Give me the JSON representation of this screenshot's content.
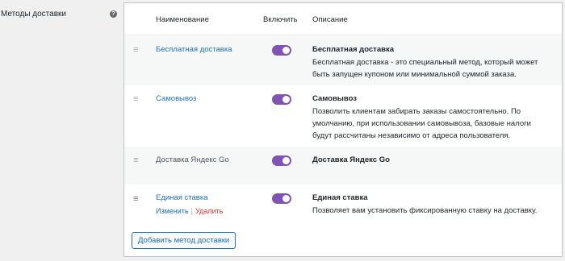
{
  "section": {
    "label": "Методы доставки",
    "help_glyph": "?"
  },
  "table": {
    "headers": {
      "name": "Наименование",
      "enable": "Включить",
      "description": "Описание"
    },
    "rows": [
      {
        "name": "Бесплатная доставка",
        "enabled": true,
        "desc_title": "Бесплатная доставка",
        "desc_text": "Бесплатная доставка - это специальный метод, который может быть запущен купоном или минимальной суммой заказа."
      },
      {
        "name": "Самовывоз",
        "enabled": true,
        "desc_title": "Самовывоз",
        "desc_text": "Позволить клиентам забирать заказы самостоятельно. По умолчанию, при использовании самовывоза, базовые налоги будут рассчитаны независимо от адреса пользователя."
      },
      {
        "name": "Доставка Яндекс Go",
        "enabled": true,
        "desc_title": "Доставка Яндекс Go",
        "desc_text": ""
      },
      {
        "name": "Единая ставка",
        "enabled": true,
        "desc_title": "Единая ставка",
        "desc_text": "Позволяет вам установить фиксированную ставку на доставку.",
        "actions": {
          "edit": "Изменить",
          "separator": "|",
          "delete": "Удалить"
        }
      }
    ],
    "handle_glyph": "≡",
    "add_button": "Добавить метод доставки"
  },
  "colors": {
    "toggle_on": "#7f54b3",
    "link": "#2271b1",
    "delete": "#d63638"
  }
}
